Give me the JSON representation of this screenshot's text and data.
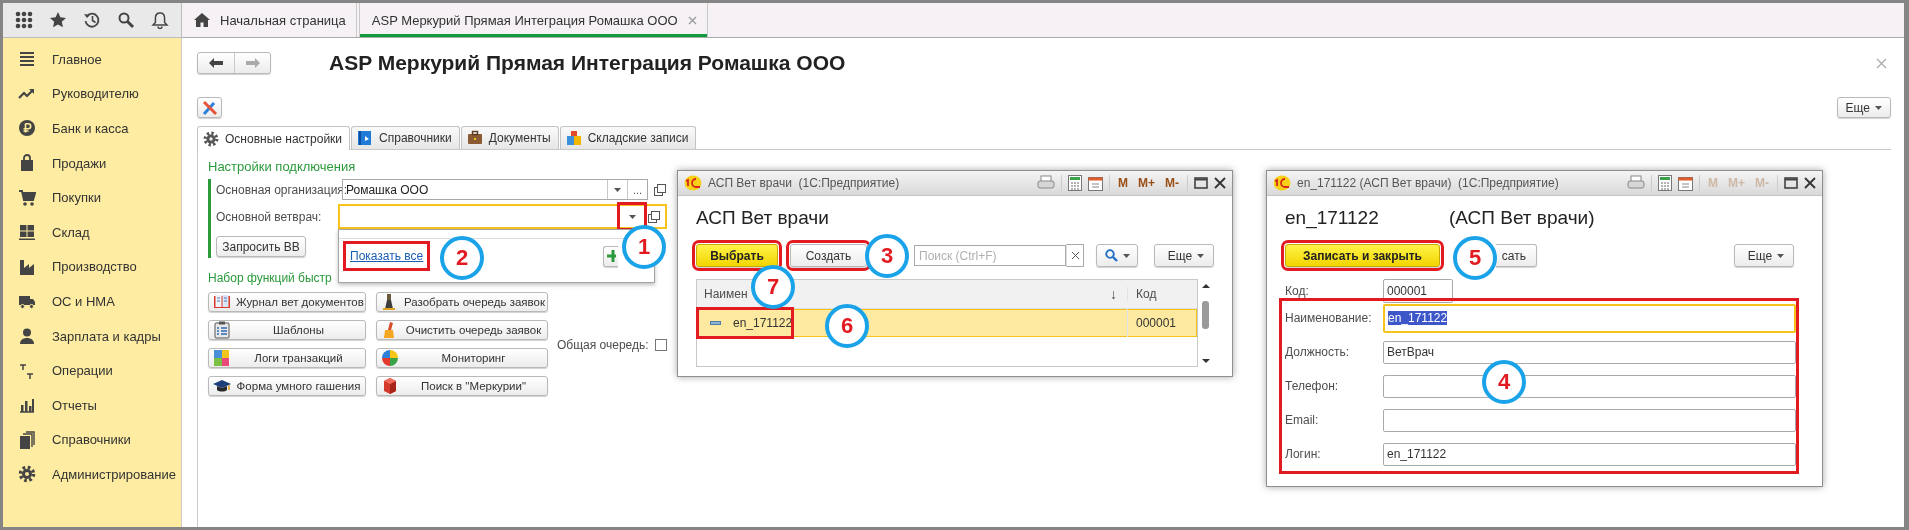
{
  "sidebar": {
    "items": [
      {
        "label": "Главное"
      },
      {
        "label": "Руководителю"
      },
      {
        "label": "Банк и касса"
      },
      {
        "label": "Продажи"
      },
      {
        "label": "Покупки"
      },
      {
        "label": "Склад"
      },
      {
        "label": "Производство"
      },
      {
        "label": "ОС и НМА"
      },
      {
        "label": "Зарплата и кадры"
      },
      {
        "label": "Операции"
      },
      {
        "label": "Отчеты"
      },
      {
        "label": "Справочники"
      },
      {
        "label": "Администрирование"
      }
    ]
  },
  "open_tabs": [
    {
      "label": "Начальная страница",
      "kind": "home",
      "selected": false
    },
    {
      "label": "ASP Меркурий Прямая Интеграция Ромашка ООО",
      "kind": "document",
      "selected": true
    }
  ],
  "form": {
    "title": "ASP Меркурий Прямая Интеграция Ромашка ООО",
    "more_button": "Еще",
    "tabs": [
      {
        "label": "Основные настройки",
        "selected": true
      },
      {
        "label": "Справочники",
        "selected": false
      },
      {
        "label": "Документы",
        "selected": false
      },
      {
        "label": "Складские записи",
        "selected": false
      }
    ],
    "connection_heading": "Настройки подключения",
    "organization": {
      "label": "Основная организация:",
      "value": "Ромашка ООО",
      "more": "..."
    },
    "vet": {
      "label": "Основной ветврач:",
      "focused": true,
      "dropdown_highlighted": true
    },
    "request_button": "Запросить ВВ",
    "dropdown": {
      "link": "Показать все",
      "link_highlighted": true
    },
    "functions_heading": "Набор функций быстр",
    "function_buttons": [
      {
        "label": "Журнал вет документов"
      },
      {
        "label": "Разобрать очередь заявок"
      },
      {
        "label": "Шаблоны"
      },
      {
        "label": "Очистить очередь заявок"
      },
      {
        "label": "Логи транзакций"
      },
      {
        "label": "Мониторинг"
      },
      {
        "label": "Форма умного гашения"
      },
      {
        "label": "Поиск в \"Меркурии\""
      }
    ],
    "shared_queue": {
      "label": "Общая очередь:",
      "checked": false
    }
  },
  "windows": [
    {
      "kind": "list",
      "caption": "АСП Вет врачи  (1С:Предприятие)",
      "memory_buttons": [
        {
          "label": "M",
          "disabled": false
        },
        {
          "label": "M+",
          "disabled": false
        },
        {
          "label": "M-",
          "disabled": false
        }
      ],
      "title": "АСП Вет врачи",
      "buttons": [
        {
          "label": "Выбрать",
          "kind": "default",
          "highlighted": true
        },
        {
          "label": "Создать",
          "kind": "normal",
          "highlighted": true
        }
      ],
      "search": {
        "placeholder": "Поиск (Ctrl+F)"
      },
      "more_button": "Еще",
      "columns": [
        {
          "label": "Наимен",
          "sort": "↓"
        },
        {
          "label": "Код"
        }
      ],
      "rows": [
        {
          "cells": [
            "en_171122",
            "000001"
          ],
          "selected": true,
          "highlighted": true
        }
      ]
    },
    {
      "kind": "item",
      "caption": "en_171122 (АСП Вет врачи)  (1С:Предприятие)",
      "memory_buttons": [
        {
          "label": "M",
          "disabled": true
        },
        {
          "label": "M+",
          "disabled": true
        },
        {
          "label": "M-",
          "disabled": true
        }
      ],
      "title": "en_171122",
      "subtitle": "(АСП Вет врачи)",
      "buttons": [
        {
          "label": "Записать и закрыть",
          "kind": "default",
          "highlighted": true
        },
        {
          "label": "сать",
          "kind": "normal",
          "highlighted": false
        }
      ],
      "more_button": "Еще",
      "code": {
        "label": "Код:",
        "value": "000001"
      },
      "fields_highlighted": true,
      "fields": [
        {
          "label": "Наименование:",
          "value": "en_171122",
          "focused": true,
          "text_selected": true
        },
        {
          "label": "Должность:",
          "value": "ВетВрач",
          "focused": false,
          "text_selected": false
        },
        {
          "label": "Телефон:",
          "focused": false
        },
        {
          "label": "Email:",
          "focused": false
        },
        {
          "label": "Логин:",
          "value": "en_171122",
          "focused": false,
          "text_selected": false
        }
      ]
    }
  ],
  "callouts": [
    {
      "number": "1"
    },
    {
      "number": "2"
    },
    {
      "number": "3"
    },
    {
      "number": "4"
    },
    {
      "number": "5"
    },
    {
      "number": "6"
    },
    {
      "number": "7"
    }
  ]
}
